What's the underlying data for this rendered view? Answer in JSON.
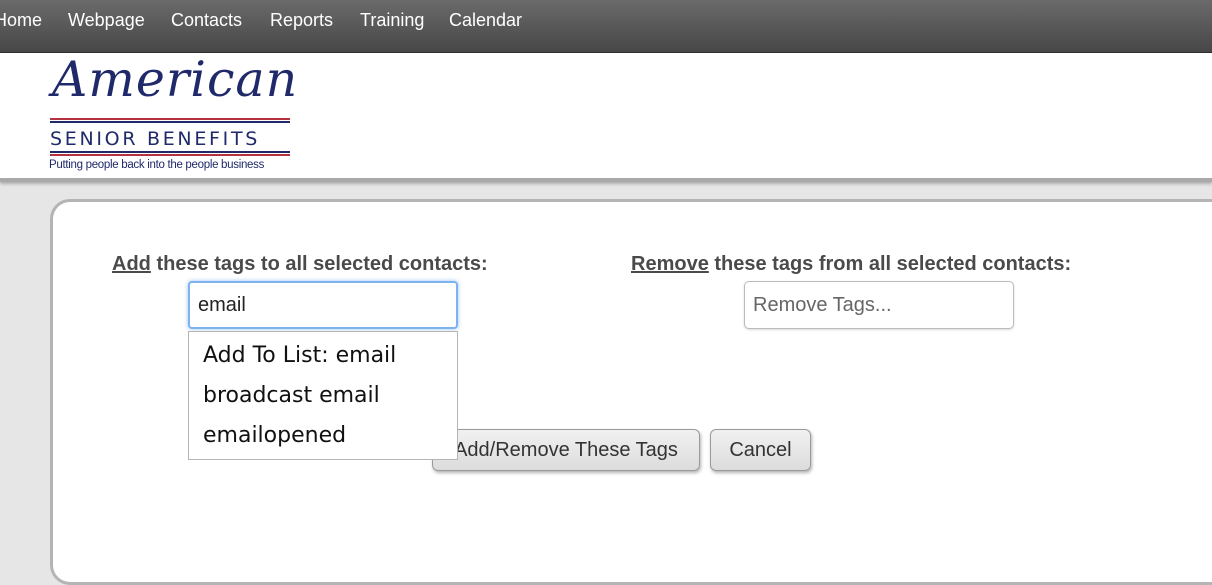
{
  "nav": {
    "items": [
      "Home",
      "Webpage",
      "Contacts",
      "Reports",
      "Training",
      "Calendar"
    ]
  },
  "logo": {
    "script": "American",
    "subtitle": "SENIOR BENEFITS",
    "tagline": "Putting people back into the people business"
  },
  "add_section": {
    "label_underlined": "Add",
    "label_rest": " these tags to all selected contacts:",
    "input_value": "email",
    "suggestions": [
      "Add To List: email",
      "broadcast email",
      "emailopened"
    ]
  },
  "remove_section": {
    "label_underlined": "Remove",
    "label_rest": " these tags from all selected contacts:",
    "input_placeholder": "Remove Tags..."
  },
  "buttons": {
    "apply": "Add/Remove These Tags",
    "cancel": "Cancel"
  }
}
